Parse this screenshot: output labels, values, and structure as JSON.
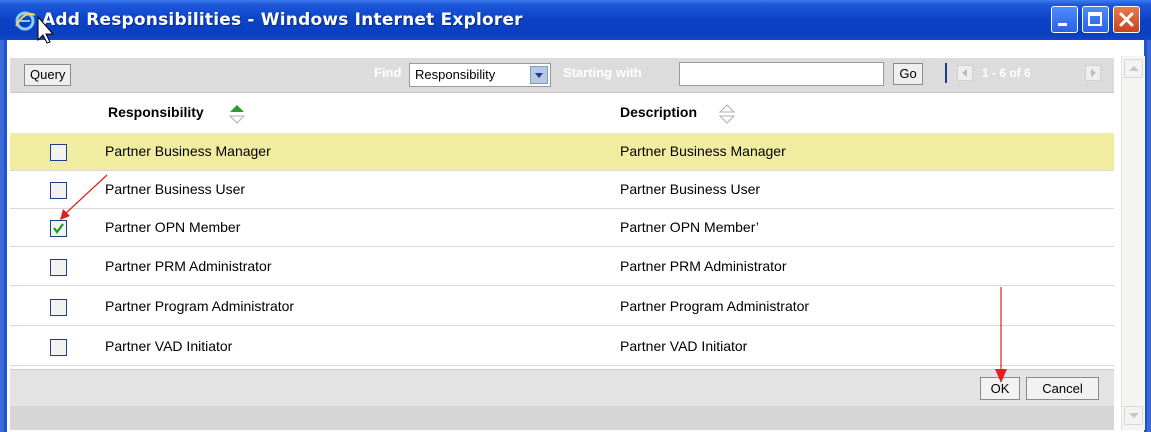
{
  "window": {
    "title": "Add Responsibilities - Windows Internet Explorer",
    "controls": [
      "minimize-icon",
      "maximize-icon",
      "close-icon"
    ]
  },
  "toolbar": {
    "query_label": "Query",
    "find_label": "Find",
    "find_selected": "Responsibility",
    "starting_label": "Starting with",
    "starting_value": "",
    "go_label": "Go",
    "range_label": "1 - 6 of 6"
  },
  "table": {
    "columns": [
      "Responsibility",
      "Description"
    ],
    "rows": [
      {
        "name": "Partner Business Manager",
        "description": "Partner Business Manager",
        "checked": false,
        "highlighted": true
      },
      {
        "name": "Partner Business User",
        "description": "Partner Business User",
        "checked": false,
        "highlighted": false
      },
      {
        "name": "Partner OPN Member",
        "description": "Partner OPN Member’",
        "checked": true,
        "highlighted": false
      },
      {
        "name": "Partner PRM Administrator",
        "description": "Partner PRM Administrator",
        "checked": false,
        "highlighted": false
      },
      {
        "name": "Partner Program Administrator",
        "description": "Partner Program Administrator",
        "checked": false,
        "highlighted": false
      },
      {
        "name": "Partner VAD Initiator",
        "description": "Partner VAD Initiator",
        "checked": false,
        "highlighted": false
      }
    ]
  },
  "buttons": {
    "ok": "OK",
    "cancel": "Cancel"
  },
  "colors": {
    "titlebar": "#0a43c7",
    "highlight_row": "#f0eda0",
    "toolbar_bg": "#dcdcdc",
    "annotation_arrow": "#e02020"
  }
}
